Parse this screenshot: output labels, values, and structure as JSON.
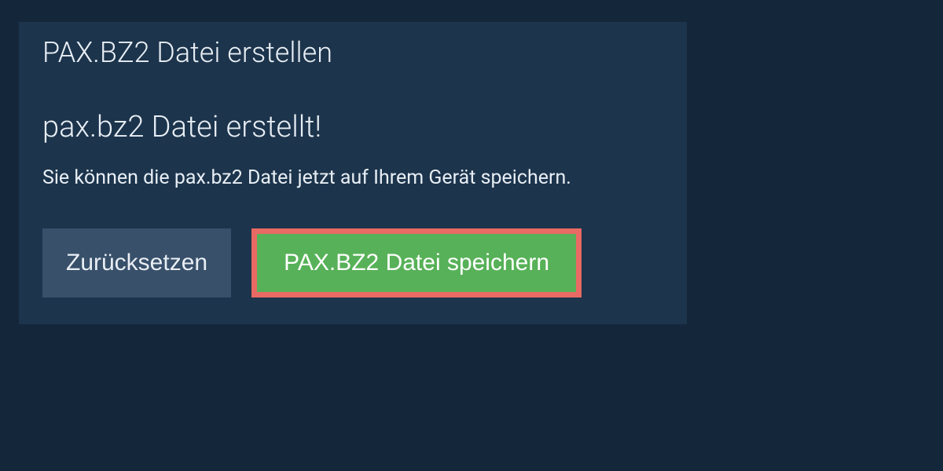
{
  "tab": {
    "label": "PAX.BZ2 Datei erstellen"
  },
  "content": {
    "heading": "pax.bz2 Datei erstellt!",
    "description": "Sie können die pax.bz2 Datei jetzt auf Ihrem Gerät speichern."
  },
  "buttons": {
    "reset_label": "Zurücksetzen",
    "save_label": "PAX.BZ2 Datei speichern"
  },
  "colors": {
    "page_bg": "#14273a",
    "panel_bg": "#1c344c",
    "reset_bg": "#38506a",
    "save_bg": "#57b158",
    "highlight_border": "#e96a64"
  }
}
